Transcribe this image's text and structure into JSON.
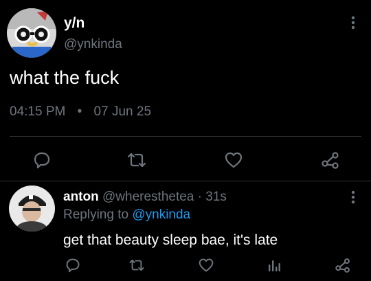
{
  "main_tweet": {
    "display_name": "y/n",
    "handle": "@ynkinda",
    "text": "what the fuck",
    "time": "04:15 PM",
    "separator": "•",
    "date": "07 Jun 25"
  },
  "reply": {
    "display_name": "anton",
    "handle": "@wheresthetea",
    "dot": "·",
    "age": "31s",
    "replying_prefix": "Replying to",
    "replying_handle": "@ynkinda",
    "text": "get that beauty sleep bae, it's late"
  },
  "colors": {
    "background": "#000000",
    "muted": "#6e767d",
    "link": "#1d9bf0",
    "divider": "#2f3336"
  },
  "icons": {
    "main_actions": [
      "reply-icon",
      "retweet-icon",
      "like-icon",
      "share-icon"
    ],
    "reply_actions": [
      "reply-icon",
      "retweet-icon",
      "like-icon",
      "analytics-icon",
      "share-icon"
    ],
    "more": "more-vertical-icon"
  }
}
